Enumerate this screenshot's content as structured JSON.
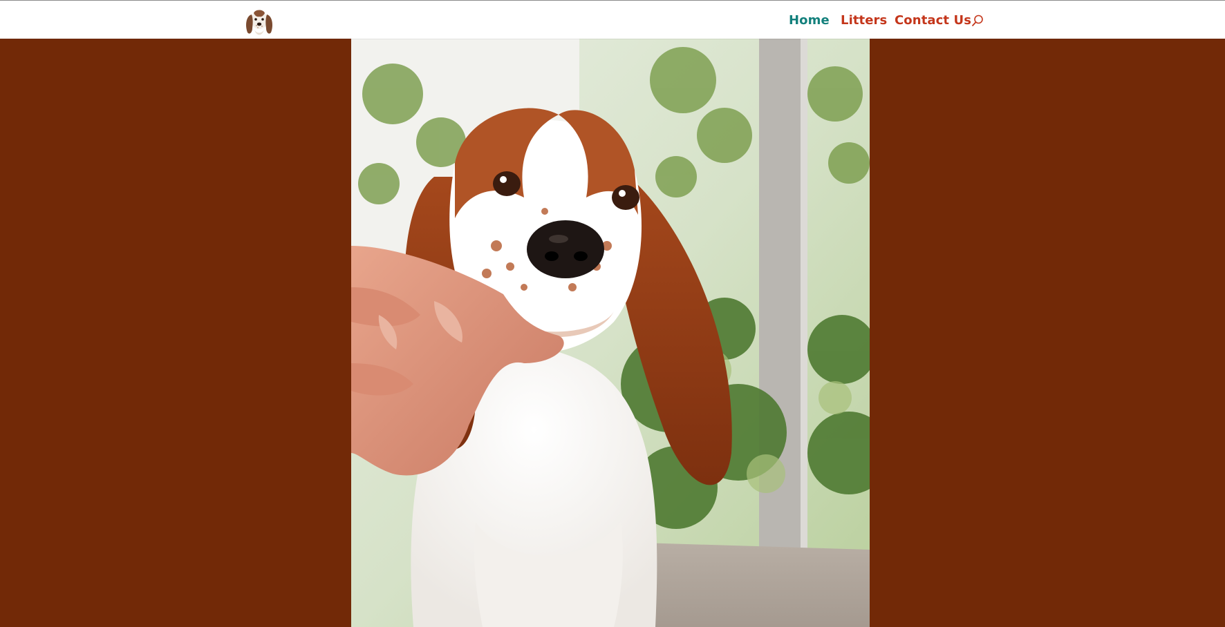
{
  "header": {
    "logo_alt": "Welsh springer spaniel puppy logo"
  },
  "nav": {
    "items": [
      {
        "label": "Home",
        "active": true
      },
      {
        "label": "Litters",
        "active": false
      },
      {
        "label": "Contact Us",
        "active": false
      }
    ],
    "search_icon": "search-icon"
  },
  "hero": {
    "image_alt": "Red and white spaniel puppy with a hand holding its chin"
  },
  "colors": {
    "page_background": "#722907",
    "nav_active": "#13807c",
    "nav_link": "#c4361b",
    "header_background": "#ffffff"
  }
}
